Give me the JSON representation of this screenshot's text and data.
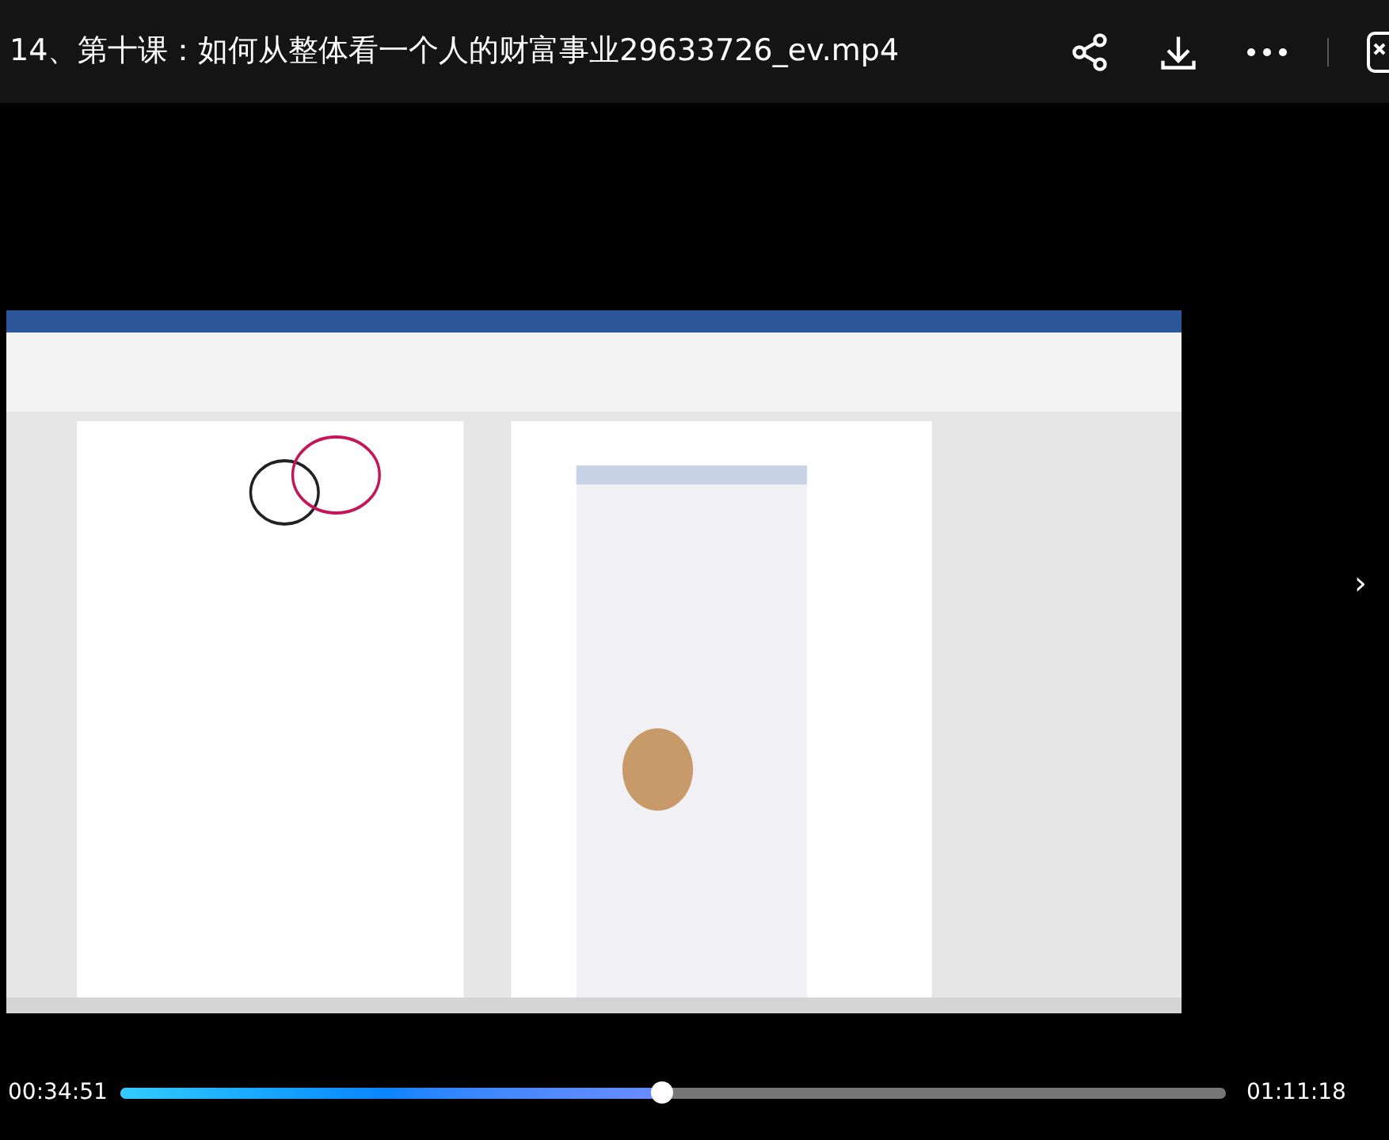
{
  "window": {
    "title": "14、第十课：如何从整体看一个人的财富事业29633726_ev.mp4"
  },
  "video": {
    "kind": "picture",
    "next_button": "›"
  },
  "player": {
    "current_time": "00:34:51",
    "duration": "01:11:18",
    "progress": {
      "level": 0.49
    }
  }
}
